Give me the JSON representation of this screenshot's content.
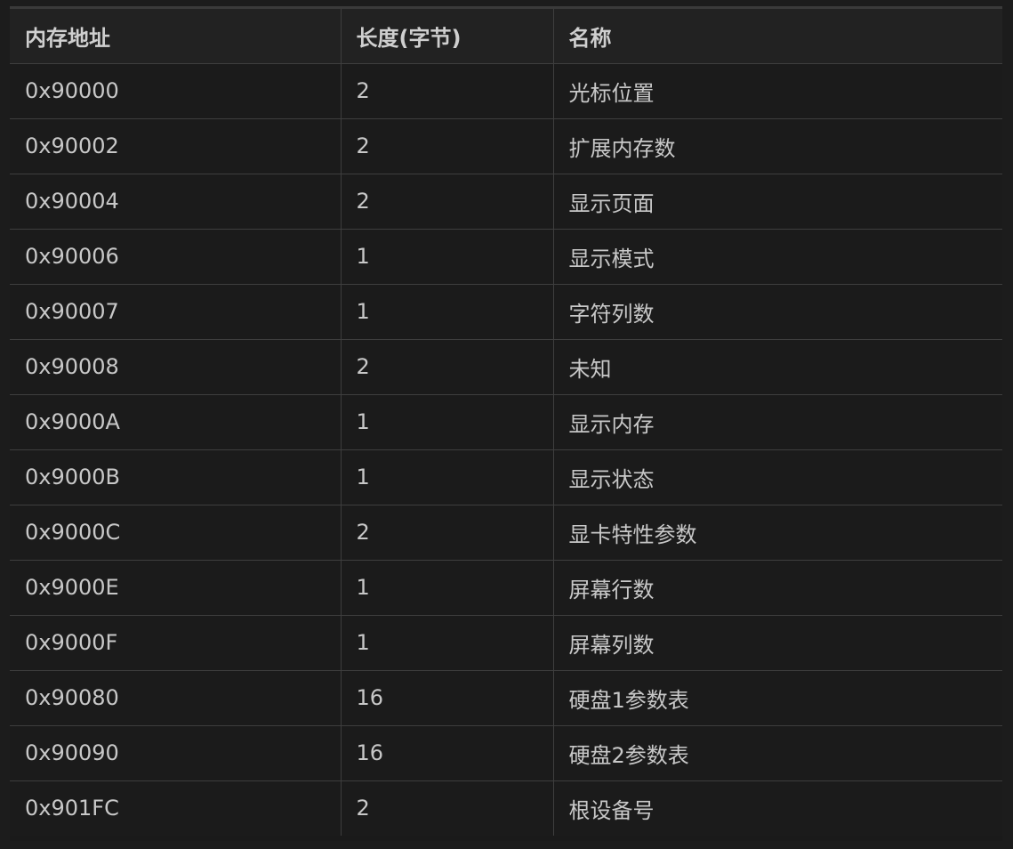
{
  "table": {
    "headers": [
      "内存地址",
      "长度(字节)",
      "名称"
    ],
    "rows": [
      [
        "0x90000",
        "2",
        "光标位置"
      ],
      [
        "0x90002",
        "2",
        "扩展内存数"
      ],
      [
        "0x90004",
        "2",
        "显示页面"
      ],
      [
        "0x90006",
        "1",
        "显示模式"
      ],
      [
        "0x90007",
        "1",
        "字符列数"
      ],
      [
        "0x90008",
        "2",
        "未知"
      ],
      [
        "0x9000A",
        "1",
        "显示内存"
      ],
      [
        "0x9000B",
        "1",
        "显示状态"
      ],
      [
        "0x9000C",
        "2",
        "显卡特性参数"
      ],
      [
        "0x9000E",
        "1",
        "屏幕行数"
      ],
      [
        "0x9000F",
        "1",
        "屏幕列数"
      ],
      [
        "0x90080",
        "16",
        "硬盘1参数表"
      ],
      [
        "0x90090",
        "16",
        "硬盘2参数表"
      ],
      [
        "0x901FC",
        "2",
        "根设备号"
      ]
    ]
  }
}
